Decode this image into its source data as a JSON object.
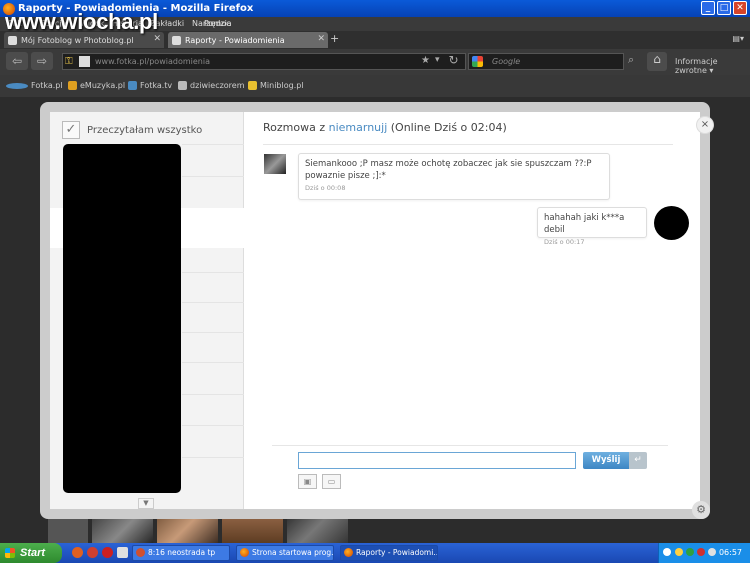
{
  "window": {
    "title": "Raporty - Powiadomienia - Mozilla Firefox",
    "buttons": [
      "_",
      "□",
      "✕"
    ]
  },
  "watermark": "www.wiocha.pl",
  "menu": [
    "Plik",
    "Edycja",
    "Widok",
    "Historia",
    "Zakładki",
    "Narzędzia",
    "Pomoc"
  ],
  "tabs": [
    {
      "label": "Mój Fotoblog w Photoblog.pl",
      "active": false
    },
    {
      "label": "Raporty - Powiadomienia",
      "active": true
    }
  ],
  "nav": {
    "url": "www.fotka.pl/powiadomienia",
    "search_placeholder": "Google",
    "info_label": "Informacje zwrotne"
  },
  "bookmarks": [
    {
      "label": "Fotka.pl",
      "color": "#4a8bc2"
    },
    {
      "label": "eMuzyka.pl",
      "color": "#e0a020"
    },
    {
      "label": "Fotka.tv",
      "color": "#4a8bc2"
    },
    {
      "label": "dziwieczorem",
      "color": "#bbbbbb"
    },
    {
      "label": "Miniblog.pl",
      "color": "#e8c030"
    }
  ],
  "modal": {
    "mark_all_read": "Przeczytałam wszystko",
    "header": {
      "prefix": "Rozmowa z",
      "username": "niemarnujj",
      "status": "(Online Dziś o 02:04)"
    },
    "messages": [
      {
        "text": "Siemankooo ;P masz może ochotę zobaczec jak sie spuszczam ??:P powaznie pisze ;]:*",
        "time": "Dziś o 00:08"
      },
      {
        "text": "hahahah jaki k***a debil",
        "time": "Dziś o 00:17"
      }
    ],
    "input_value": "",
    "send_label": "Wyślij",
    "close_label": "×"
  },
  "taskbar": {
    "start_label": "Start",
    "tasks": [
      {
        "label": "8:16 neostrada tp",
        "active": false
      },
      {
        "label": "Strona startowa prog...",
        "active": false
      },
      {
        "label": "Raporty - Powiadomi...",
        "active": true
      }
    ],
    "clock": "06:57"
  }
}
